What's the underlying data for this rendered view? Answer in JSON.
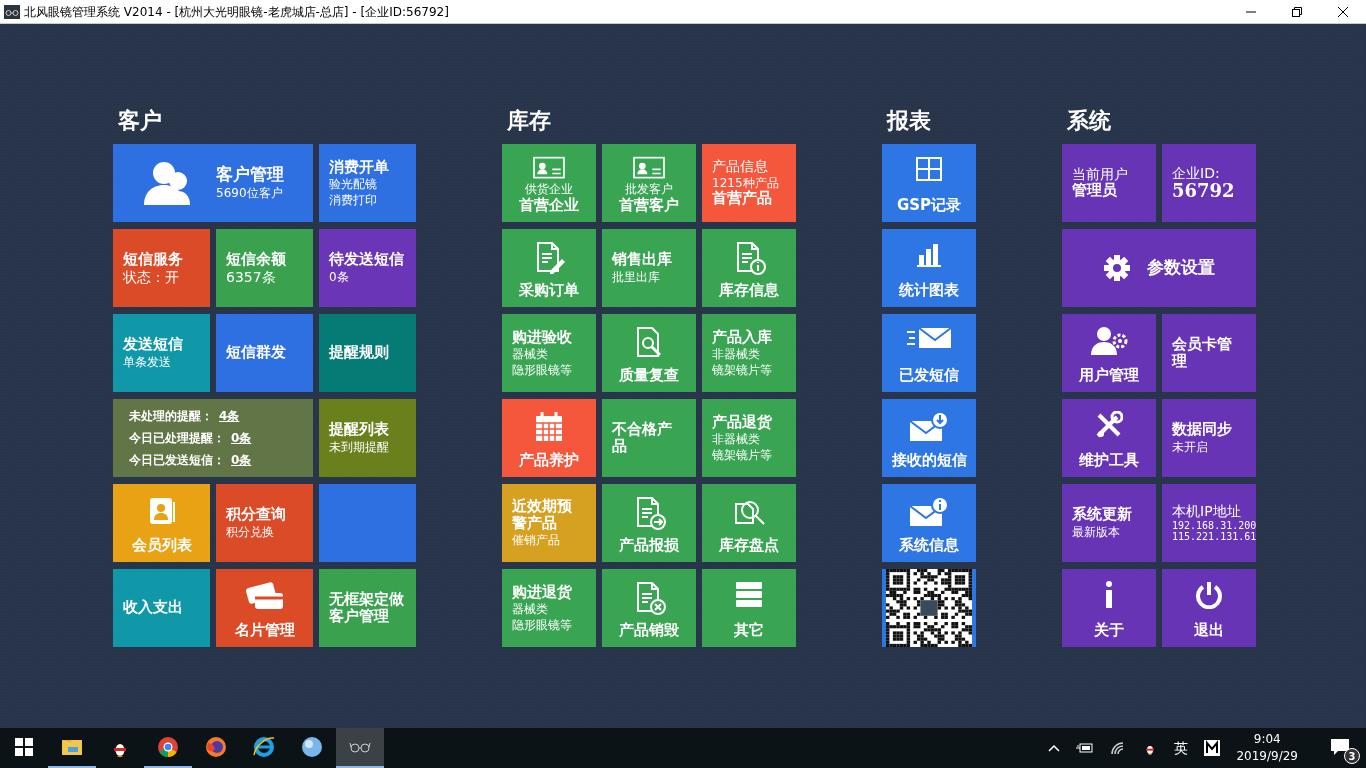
{
  "window": {
    "title": "北风眼镜管理系统 V2014 - [杭州大光明眼镜-老虎城店-总店] - [企业ID:56792]"
  },
  "sections": [
    {
      "title": "客户",
      "tiles": [
        {
          "kind": "wide",
          "color": "#2e6fe2",
          "lines": [
            {
              "kind": "title",
              "text": "客户管理"
            },
            {
              "kind": "note",
              "text": "5690位客户"
            }
          ]
        },
        {
          "kind": "text",
          "color": "#2e6fe2",
          "lines": [
            {
              "kind": "title",
              "text": "消费开单"
            },
            {
              "kind": "note",
              "text": "验光配镜"
            },
            {
              "kind": "note",
              "text": "消费打印"
            }
          ]
        },
        {
          "kind": "text",
          "color": "#dc4b27",
          "lines": [
            {
              "kind": "title",
              "text": "短信服务"
            },
            {
              "kind": "label",
              "text": "状态：开"
            }
          ]
        },
        {
          "kind": "text",
          "color": "#3aa14f",
          "lines": [
            {
              "kind": "title",
              "text": "短信余额"
            },
            {
              "kind": "label",
              "text": "6357条"
            }
          ]
        },
        {
          "kind": "text",
          "color": "#6a35b6",
          "lines": [
            {
              "kind": "title",
              "text": "待发送短信"
            },
            {
              "kind": "note",
              "text": "0条"
            }
          ]
        },
        {
          "kind": "text",
          "color": "#1198a8",
          "lines": [
            {
              "kind": "title",
              "text": "发送短信"
            },
            {
              "kind": "note",
              "text": "单条发送"
            }
          ]
        },
        {
          "kind": "text",
          "color": "#2e6fe2",
          "lines": [
            {
              "kind": "title",
              "text": "短信群发"
            }
          ]
        },
        {
          "kind": "text",
          "color": "#057b76",
          "lines": [
            {
              "kind": "title",
              "text": "提醒规则"
            }
          ]
        },
        {
          "kind": "stats",
          "color": "#627547",
          "items": [
            {
              "label": "未处理的提醒：",
              "value": "4条"
            },
            {
              "label": "今日已处理提醒：",
              "value": "0条"
            },
            {
              "label": "今日已发送短信：",
              "value": "0条"
            }
          ]
        },
        {
          "kind": "text",
          "color": "#6a801c",
          "lines": [
            {
              "kind": "title",
              "text": "提醒列表"
            },
            {
              "kind": "note",
              "text": "未到期提醒"
            }
          ]
        },
        {
          "kind": "icon",
          "color": "#e8a214",
          "lines": [
            {
              "kind": "title",
              "text": "会员列表"
            }
          ]
        },
        {
          "kind": "text",
          "color": "#dc4b27",
          "lines": [
            {
              "kind": "title",
              "text": "积分查询"
            },
            {
              "kind": "note",
              "text": "积分兑换"
            }
          ]
        },
        {
          "kind": "blank",
          "color": "#2e6fe2"
        },
        {
          "kind": "text",
          "color": "#1198a8",
          "lines": [
            {
              "kind": "title",
              "text": "收入支出"
            }
          ]
        },
        {
          "kind": "icon",
          "color": "#dc4b27",
          "lines": [
            {
              "kind": "title",
              "text": "名片管理"
            }
          ]
        },
        {
          "kind": "text",
          "color": "#3aa14f",
          "lines": [
            {
              "kind": "title",
              "text": "无框架定做客户管理"
            }
          ]
        }
      ]
    },
    {
      "title": "库存",
      "tiles": [
        {
          "kind": "icon",
          "color": "#39a553",
          "lines": [
            {
              "kind": "note",
              "text": "供货企业"
            },
            {
              "kind": "title",
              "text": "首营企业"
            }
          ]
        },
        {
          "kind": "icon",
          "color": "#39a553",
          "lines": [
            {
              "kind": "note",
              "text": "批发客户"
            },
            {
              "kind": "title",
              "text": "首营客户"
            }
          ]
        },
        {
          "kind": "text",
          "color": "#f5573c",
          "lines": [
            {
              "kind": "label",
              "text": "产品信息"
            },
            {
              "kind": "note",
              "text": "1215种产品"
            },
            {
              "kind": "title",
              "text": "首营产品"
            }
          ]
        },
        {
          "kind": "icon",
          "color": "#39a553",
          "lines": [
            {
              "kind": "title",
              "text": "采购订单"
            }
          ]
        },
        {
          "kind": "text",
          "color": "#39a553",
          "lines": [
            {
              "kind": "title",
              "text": "销售出库"
            },
            {
              "kind": "note",
              "text": "批里出库"
            }
          ]
        },
        {
          "kind": "icon",
          "color": "#39a553",
          "lines": [
            {
              "kind": "title",
              "text": "库存信息"
            }
          ]
        },
        {
          "kind": "text",
          "color": "#39a553",
          "lines": [
            {
              "kind": "title",
              "text": "购进验收"
            },
            {
              "kind": "note",
              "text": "器械类"
            },
            {
              "kind": "note",
              "text": "隐形眼镜等"
            }
          ]
        },
        {
          "kind": "icon",
          "color": "#39a553",
          "lines": [
            {
              "kind": "title",
              "text": "质量复查"
            }
          ]
        },
        {
          "kind": "text",
          "color": "#39a553",
          "lines": [
            {
              "kind": "title",
              "text": "产品入库"
            },
            {
              "kind": "note",
              "text": "非器械类"
            },
            {
              "kind": "note",
              "text": "镜架镜片等"
            }
          ]
        },
        {
          "kind": "icon",
          "color": "#f5573c",
          "lines": [
            {
              "kind": "title",
              "text": "产品养护"
            }
          ]
        },
        {
          "kind": "text",
          "color": "#39a553",
          "lines": [
            {
              "kind": "title",
              "text": "不合格产品"
            }
          ]
        },
        {
          "kind": "text",
          "color": "#39a553",
          "lines": [
            {
              "kind": "title",
              "text": "产品退货"
            },
            {
              "kind": "note",
              "text": "非器械类"
            },
            {
              "kind": "note",
              "text": "镜架镜片等"
            }
          ]
        },
        {
          "kind": "text",
          "color": "#d6a021",
          "lines": [
            {
              "kind": "title",
              "text": "近效期预警产品"
            },
            {
              "kind": "note",
              "text": "催销产品"
            }
          ]
        },
        {
          "kind": "icon",
          "color": "#39a553",
          "lines": [
            {
              "kind": "title",
              "text": "产品报损"
            }
          ]
        },
        {
          "kind": "icon",
          "color": "#39a553",
          "lines": [
            {
              "kind": "title",
              "text": "库存盘点"
            }
          ]
        },
        {
          "kind": "text",
          "color": "#39a553",
          "lines": [
            {
              "kind": "title",
              "text": "购进退货"
            },
            {
              "kind": "note",
              "text": "器械类"
            },
            {
              "kind": "note",
              "text": "隐形眼镜等"
            }
          ]
        },
        {
          "kind": "icon",
          "color": "#39a553",
          "lines": [
            {
              "kind": "title",
              "text": "产品销毁"
            }
          ]
        },
        {
          "kind": "icon",
          "color": "#39a553",
          "lines": [
            {
              "kind": "title",
              "text": "其它"
            }
          ]
        }
      ]
    },
    {
      "title": "报表",
      "tiles": [
        {
          "kind": "icon",
          "color": "#2e76e4",
          "lines": [
            {
              "kind": "title",
              "text": "GSP记录"
            }
          ]
        },
        {
          "kind": "icon",
          "color": "#2e76e4",
          "lines": [
            {
              "kind": "title",
              "text": "统计图表"
            }
          ]
        },
        {
          "kind": "icon",
          "color": "#2e76e4",
          "lines": [
            {
              "kind": "title",
              "text": "已发短信"
            }
          ]
        },
        {
          "kind": "icon",
          "color": "#2e76e4",
          "lines": [
            {
              "kind": "title",
              "text": "接收的短信"
            }
          ]
        },
        {
          "kind": "icon",
          "color": "#2e76e4",
          "lines": [
            {
              "kind": "title",
              "text": "系统信息"
            }
          ]
        },
        {
          "kind": "qr",
          "color": "#2e76e4"
        }
      ]
    },
    {
      "title": "系统",
      "tiles": [
        {
          "kind": "text",
          "color": "#6734b5",
          "lines": [
            {
              "kind": "label",
              "text": "当前用户"
            },
            {
              "kind": "title",
              "text": "管理员"
            }
          ]
        },
        {
          "kind": "text",
          "color": "#6734b5",
          "lines": [
            {
              "kind": "label",
              "text": "企业ID:"
            },
            {
              "kind": "number",
              "text": "56792"
            }
          ]
        },
        {
          "kind": "wide",
          "color": "#6734b5",
          "lines": [
            {
              "kind": "title",
              "text": "参数设置"
            }
          ]
        },
        {
          "kind": "icon",
          "color": "#6734b5",
          "lines": [
            {
              "kind": "title",
              "text": "用户管理"
            }
          ]
        },
        {
          "kind": "text",
          "color": "#6734b5",
          "lines": [
            {
              "kind": "title",
              "text": "会员卡管理"
            }
          ]
        },
        {
          "kind": "icon",
          "color": "#6734b5",
          "lines": [
            {
              "kind": "title",
              "text": "维护工具"
            }
          ]
        },
        {
          "kind": "text",
          "color": "#6734b5",
          "lines": [
            {
              "kind": "title",
              "text": "数据同步"
            },
            {
              "kind": "note",
              "text": "未开启"
            }
          ]
        },
        {
          "kind": "text",
          "color": "#6734b5",
          "lines": [
            {
              "kind": "title",
              "text": "系统更新"
            },
            {
              "kind": "note",
              "text": "最新版本"
            }
          ]
        },
        {
          "kind": "text",
          "color": "#6734b5",
          "lines": [
            {
              "kind": "label",
              "text": "本机IP地址"
            },
            {
              "kind": "mono",
              "text": "192.168.31.200"
            },
            {
              "kind": "mono",
              "text": "115.221.131.61"
            }
          ]
        },
        {
          "kind": "icon",
          "color": "#6734b5",
          "lines": [
            {
              "kind": "title",
              "text": "关于"
            }
          ]
        },
        {
          "kind": "icon",
          "color": "#6734b5",
          "lines": [
            {
              "kind": "title",
              "text": "退出"
            }
          ]
        }
      ]
    }
  ],
  "taskbar": {
    "apps": [
      {
        "running": true,
        "selected": false
      },
      {
        "running": false,
        "selected": false
      },
      {
        "running": true,
        "selected": false
      },
      {
        "running": false,
        "selected": false
      },
      {
        "running": false,
        "selected": false
      },
      {
        "running": false,
        "selected": false
      },
      {
        "running": true,
        "selected": true
      }
    ],
    "ime": "英",
    "time": "9:04",
    "date": "2019/9/29",
    "notifications": "3"
  }
}
